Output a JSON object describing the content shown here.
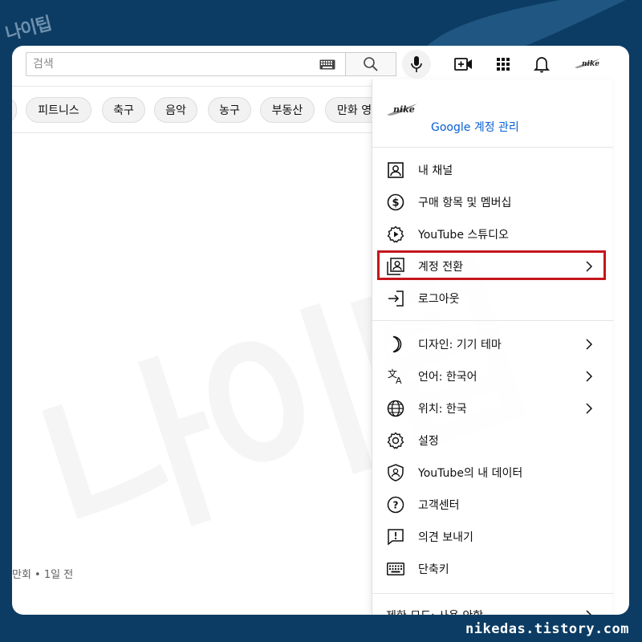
{
  "decor": {
    "corner_logo": "나이팁",
    "watermark": "나이팁",
    "footer_url": "nikedas.tistory.com",
    "highlight_color": "#c4161c"
  },
  "search": {
    "placeholder": "검색"
  },
  "icons": {
    "keyboard": "keyboard-icon",
    "search": "search-icon",
    "mic": "mic-icon",
    "create": "create-video-icon",
    "apps": "apps-grid-icon",
    "notifications": "bell-icon"
  },
  "avatar_text": "nike",
  "chips": [
    "피트니스",
    "축구",
    "음악",
    "농구",
    "부동산",
    "만화 영"
  ],
  "video_meta": "만회 • 1일 전",
  "menu": {
    "avatar_text": "nike",
    "manage_account": "Google 계정 관리",
    "section1": [
      {
        "label": "내 채널",
        "icon": "account-icon"
      },
      {
        "label": "구매 항목 및 멤버십",
        "icon": "dollar-icon"
      },
      {
        "label": "YouTube 스튜디오",
        "icon": "studio-gear-icon"
      },
      {
        "label": "계정 전환",
        "icon": "switch-account-icon",
        "chevron": true,
        "highlighted": true
      },
      {
        "label": "로그아웃",
        "icon": "logout-icon"
      }
    ],
    "section2": [
      {
        "label": "디자인: 기기 테마",
        "icon": "moon-icon",
        "chevron": true
      },
      {
        "label": "언어: 한국어",
        "icon": "translate-icon",
        "chevron": true
      },
      {
        "label": "위치: 한국",
        "icon": "globe-icon",
        "chevron": true
      },
      {
        "label": "설정",
        "icon": "settings-icon"
      },
      {
        "label": "YouTube의 내 데이터",
        "icon": "shield-person-icon"
      },
      {
        "label": "고객센터",
        "icon": "help-icon"
      },
      {
        "label": "의견 보내기",
        "icon": "feedback-icon"
      },
      {
        "label": "단축키",
        "icon": "keyboard-icon"
      }
    ],
    "restricted_mode": "제한 모드: 사용 안함"
  }
}
